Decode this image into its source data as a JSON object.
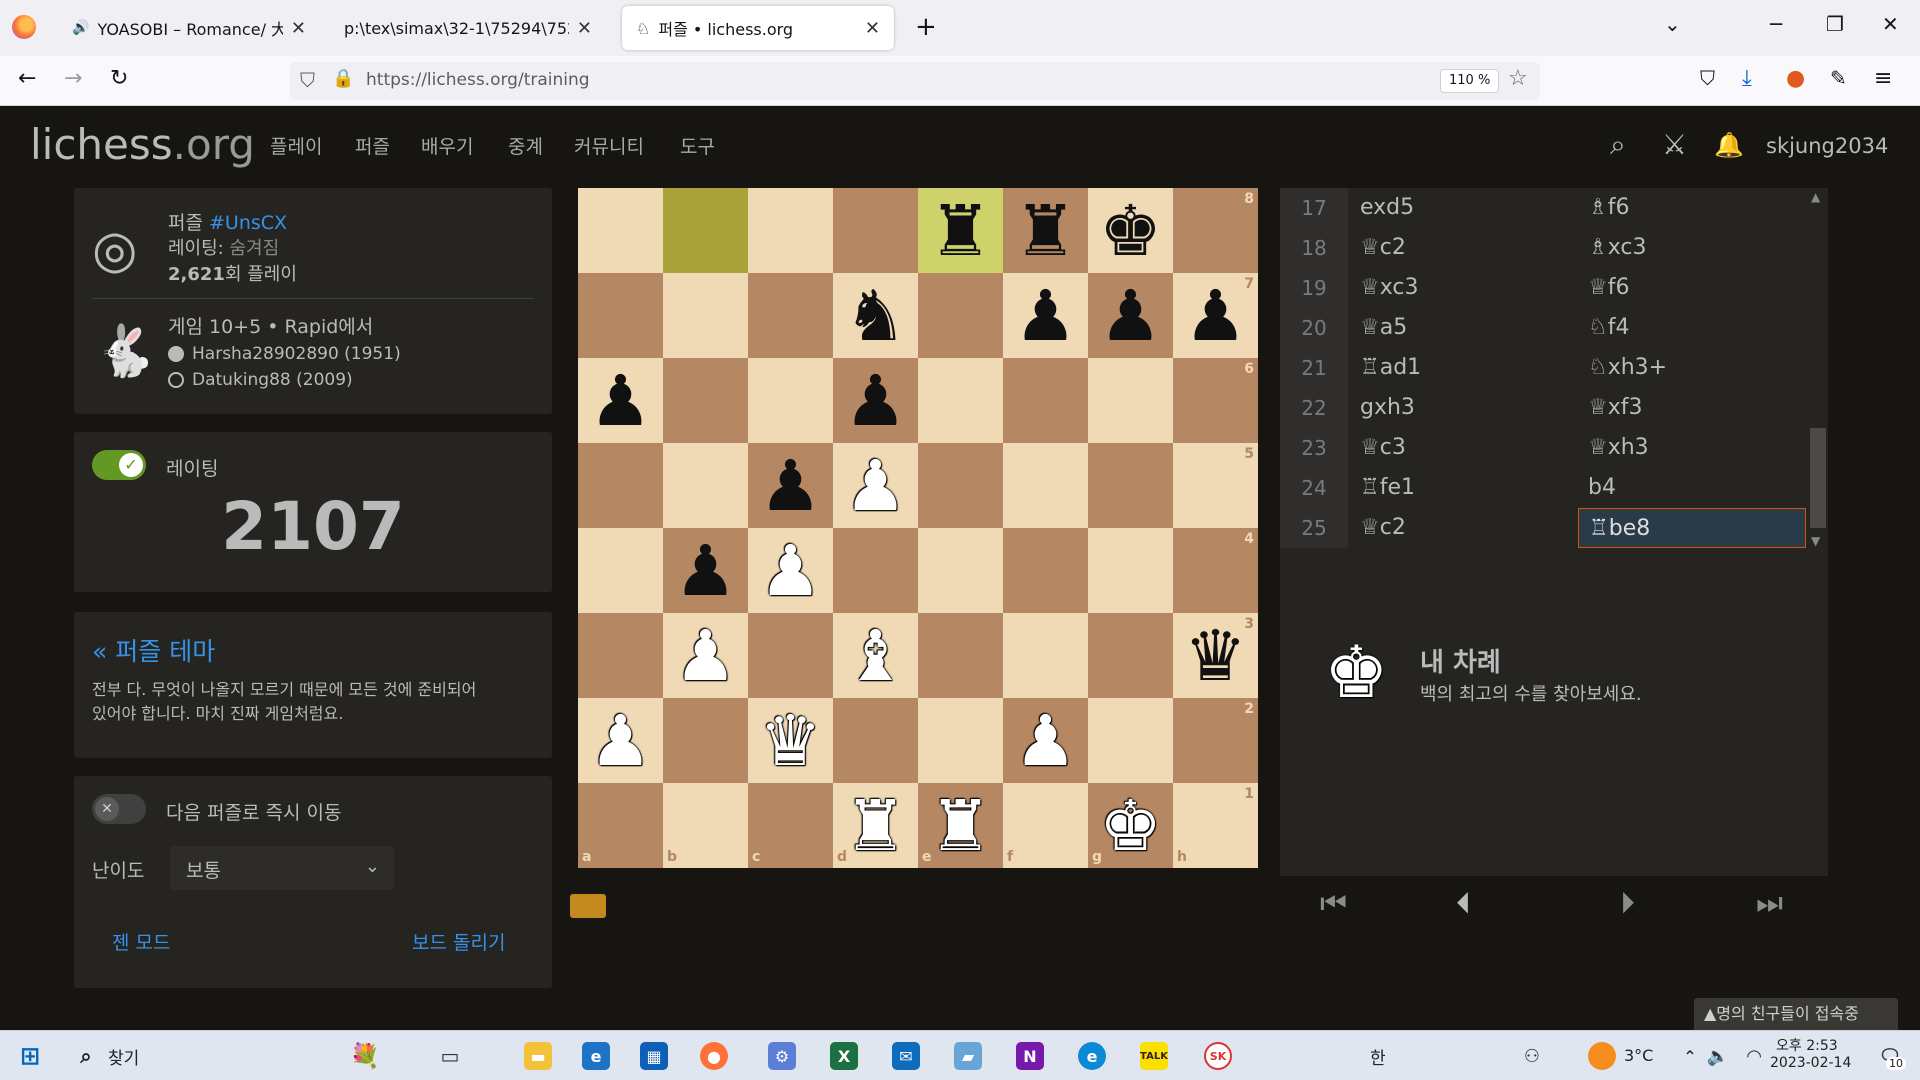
{
  "browser": {
    "tabs": [
      {
        "label": "YOASOBI – Romance/ 大正浪漫",
        "active": false
      },
      {
        "label": "p:\\tex\\simax\\32-1\\75294\\75294",
        "active": false
      },
      {
        "label": "퍼즐 • lichess.org",
        "active": true
      }
    ],
    "new_tab_label": "+",
    "url": "https://lichess.org/training",
    "zoom": "110 %"
  },
  "site": {
    "logo_main": "lichess",
    "logo_suffix": ".org",
    "menu": [
      "플레이",
      "퍼즐",
      "배우기",
      "중계",
      "커뮤니티",
      "도구"
    ],
    "username": "skjung2034"
  },
  "puzzle_info": {
    "title_prefix": "퍼즐 ",
    "puzzle_id": "#UnsCX",
    "rating_label": "레이팅: ",
    "rating_value": "숨겨짐",
    "plays_count": "2,621",
    "plays_label": "회 플레이",
    "game_title": "게임 10+5 • Rapid에서",
    "white_player": "Harsha28902890 (1951)",
    "black_player": "Datuking88 (2009)"
  },
  "rating_panel": {
    "label": "레이팅",
    "value": "2107"
  },
  "theme_panel": {
    "title": "« 퍼즐 테마",
    "description_line1": "전부 다. 무엇이 나올지 모르기 때문에 모든 것에 준비되어",
    "description_line2": "있어야 합니다. 마치 진짜 게임처럼요."
  },
  "settings_panel": {
    "auto_next_label": "다음 퍼즐로 즉시 이동",
    "difficulty_label": "난이도",
    "difficulty_value": "보통",
    "zen_mode": "젠 모드",
    "flip_board": "보드 돌리기"
  },
  "board": {
    "files": [
      "a",
      "b",
      "c",
      "d",
      "e",
      "f",
      "g",
      "h"
    ],
    "ranks": [
      "8",
      "7",
      "6",
      "5",
      "4",
      "3",
      "2",
      "1"
    ],
    "highlight_squares": [
      "b8",
      "e8"
    ],
    "pieces": [
      {
        "sq": "e8",
        "glyph": "♜",
        "color": "b",
        "name": "black-rook"
      },
      {
        "sq": "f8",
        "glyph": "♜",
        "color": "b",
        "name": "black-rook"
      },
      {
        "sq": "g8",
        "glyph": "♚",
        "color": "b",
        "name": "black-king"
      },
      {
        "sq": "d7",
        "glyph": "♞",
        "color": "b",
        "name": "black-knight"
      },
      {
        "sq": "f7",
        "glyph": "♟",
        "color": "b",
        "name": "black-pawn"
      },
      {
        "sq": "g7",
        "glyph": "♟",
        "color": "b",
        "name": "black-pawn"
      },
      {
        "sq": "h7",
        "glyph": "♟",
        "color": "b",
        "name": "black-pawn"
      },
      {
        "sq": "a6",
        "glyph": "♟",
        "color": "b",
        "name": "black-pawn"
      },
      {
        "sq": "d6",
        "glyph": "♟",
        "color": "b",
        "name": "black-pawn"
      },
      {
        "sq": "c5",
        "glyph": "♟",
        "color": "b",
        "name": "black-pawn"
      },
      {
        "sq": "d5",
        "glyph": "♟",
        "color": "w",
        "name": "white-pawn"
      },
      {
        "sq": "b4",
        "glyph": "♟",
        "color": "b",
        "name": "black-pawn"
      },
      {
        "sq": "c4",
        "glyph": "♟",
        "color": "w",
        "name": "white-pawn"
      },
      {
        "sq": "b3",
        "glyph": "♟",
        "color": "w",
        "name": "white-pawn"
      },
      {
        "sq": "d3",
        "glyph": "♝",
        "color": "w",
        "name": "white-bishop"
      },
      {
        "sq": "h3",
        "glyph": "♛",
        "color": "b",
        "name": "black-queen"
      },
      {
        "sq": "a2",
        "glyph": "♟",
        "color": "w",
        "name": "white-pawn"
      },
      {
        "sq": "c2",
        "glyph": "♛",
        "color": "w",
        "name": "white-queen"
      },
      {
        "sq": "f2",
        "glyph": "♟",
        "color": "w",
        "name": "white-pawn"
      },
      {
        "sq": "d1",
        "glyph": "♜",
        "color": "w",
        "name": "white-rook"
      },
      {
        "sq": "e1",
        "glyph": "♜",
        "color": "w",
        "name": "white-rook"
      },
      {
        "sq": "g1",
        "glyph": "♚",
        "color": "w",
        "name": "white-king"
      }
    ]
  },
  "moves": [
    {
      "n": "17",
      "w": "exd5",
      "b": "♗f6"
    },
    {
      "n": "18",
      "w": "♕c2",
      "b": "♗xc3"
    },
    {
      "n": "19",
      "w": "♕xc3",
      "b": "♕f6"
    },
    {
      "n": "20",
      "w": "♕a5",
      "b": "♘f4"
    },
    {
      "n": "21",
      "w": "♖ad1",
      "b": "♘xh3+"
    },
    {
      "n": "22",
      "w": "gxh3",
      "b": "♕xf3"
    },
    {
      "n": "23",
      "w": "♕c3",
      "b": "♕xh3"
    },
    {
      "n": "24",
      "w": "♖fe1",
      "b": "b4"
    },
    {
      "n": "25",
      "w": "♕c2",
      "b": "♖be8"
    }
  ],
  "turn_panel": {
    "title": "내 차례",
    "subtitle": "백의 최고의 수를 찾아보세요."
  },
  "friends_bar": "▲명의 친구들이 접속중",
  "taskbar": {
    "search_label": "찾기",
    "ime": "한",
    "temperature": "3°C",
    "time": "오후 2:53",
    "date": "2023-02-14",
    "notification_count": "10"
  }
}
